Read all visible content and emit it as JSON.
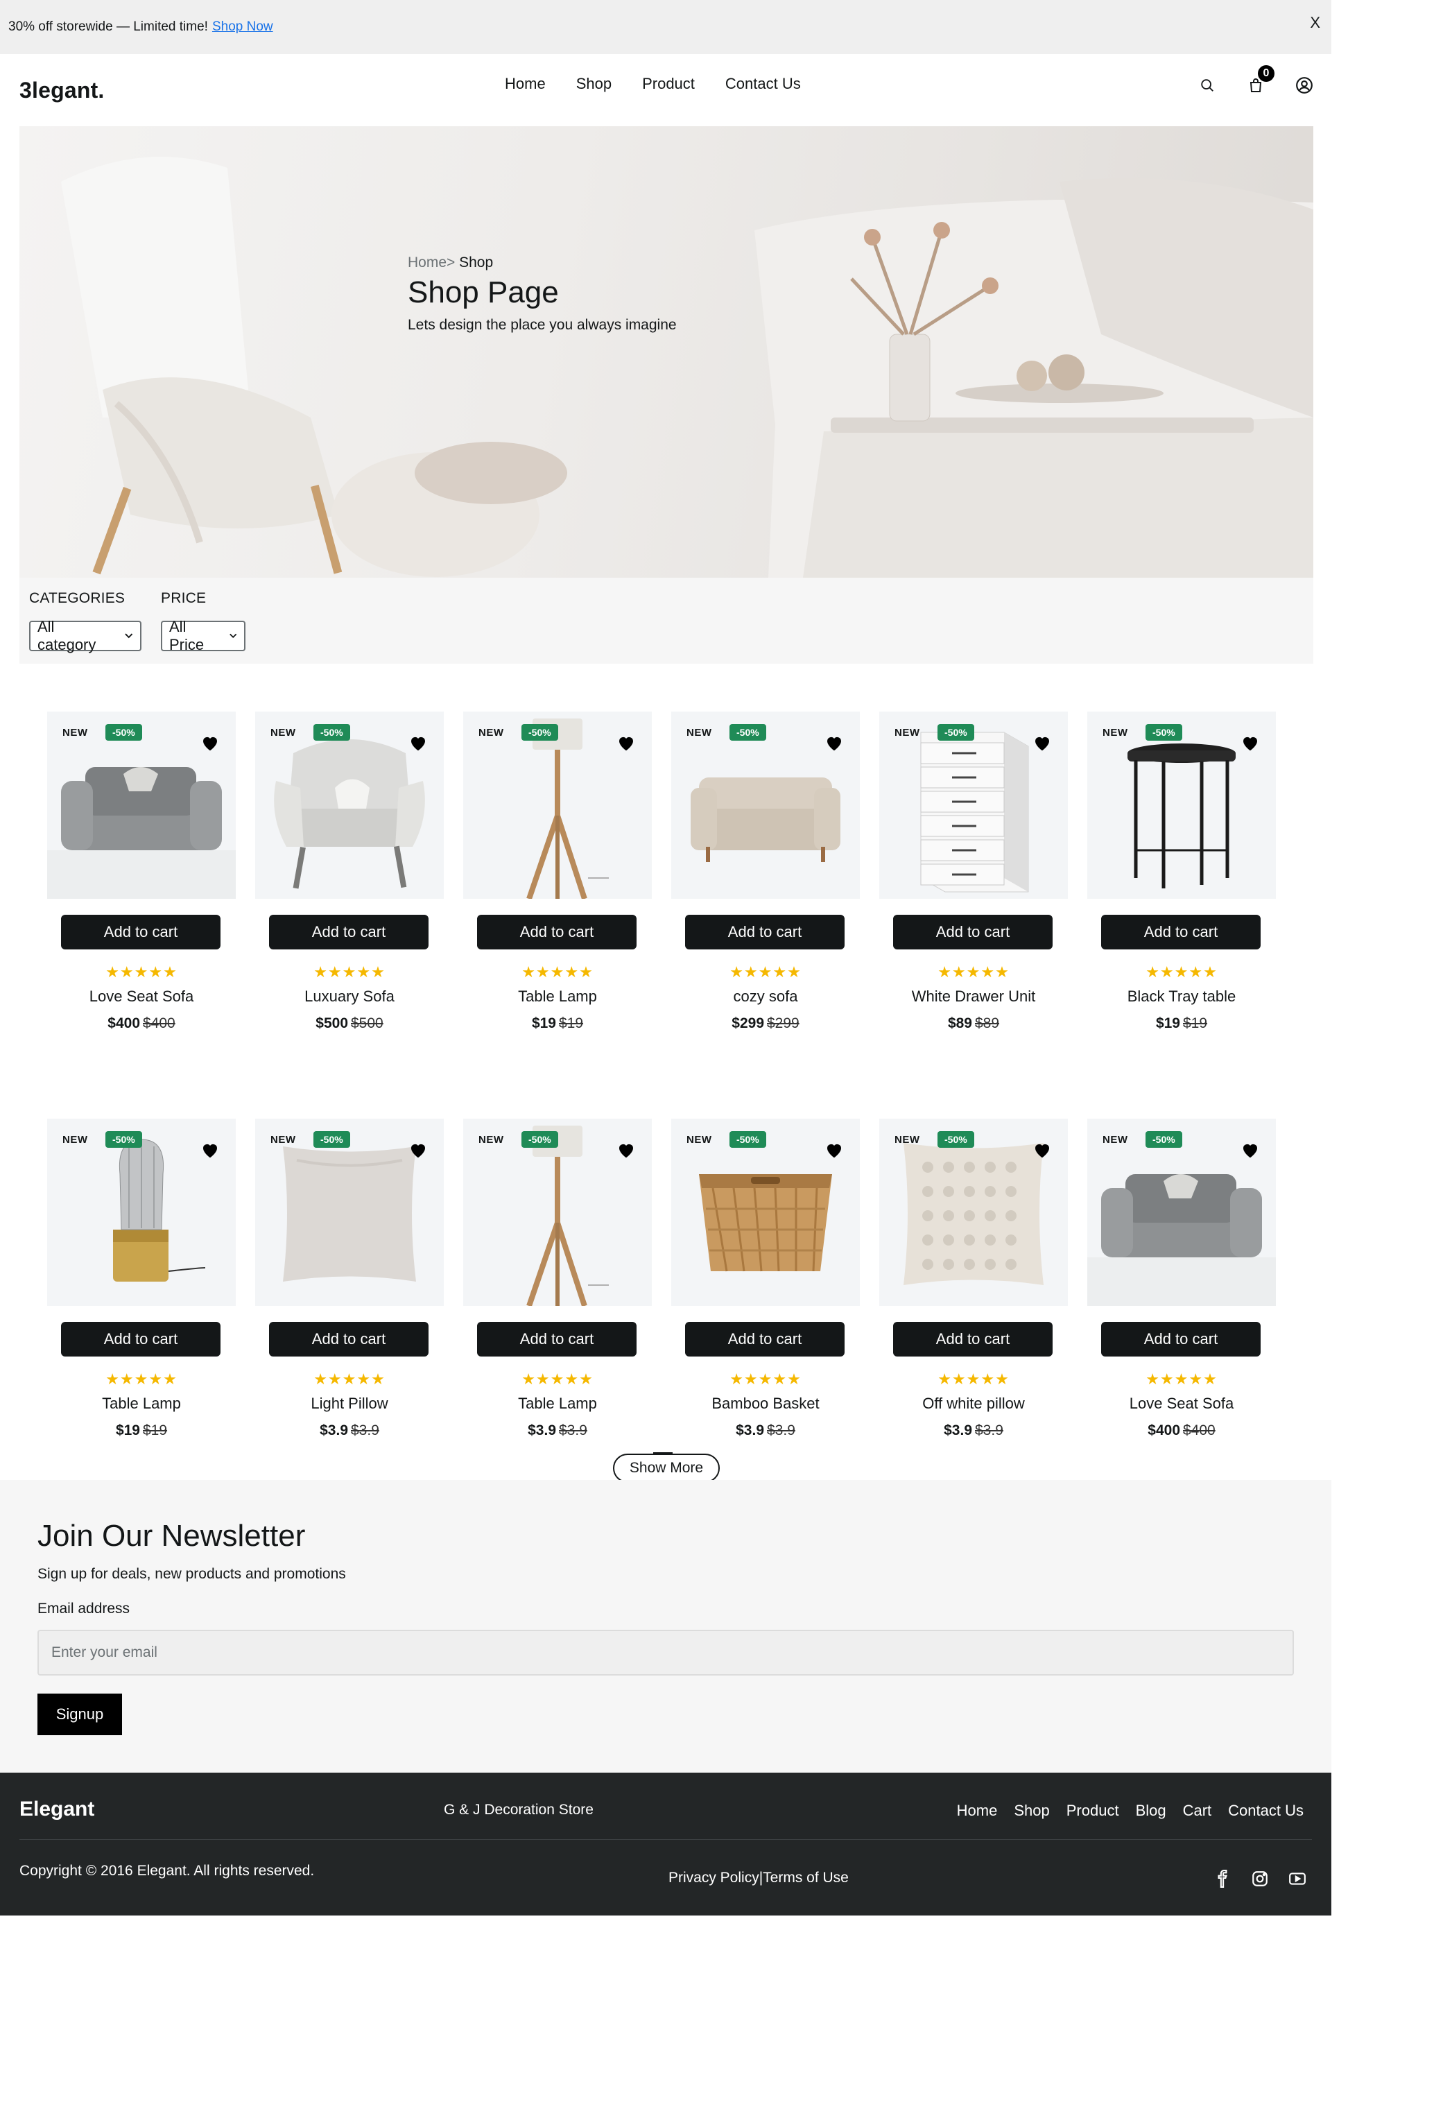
{
  "promo_bar": {
    "text": "30% off storewide — Limited time!",
    "link": "Shop Now",
    "close": "X"
  },
  "header": {
    "logo": "3legant.",
    "nav": [
      "Home",
      "Shop",
      "Product",
      "Contact Us"
    ],
    "cart_count": "0"
  },
  "hero": {
    "breadcrumb_home": "Home>",
    "breadcrumb_current": " Shop",
    "title": "Shop Page",
    "subtitle": "Lets design the place you always imagine"
  },
  "filters": {
    "categories_label": "CATEGORIES",
    "categories_value": "All category",
    "price_label": "PRICE",
    "price_value": "All Price"
  },
  "product_labels": {
    "new": "NEW",
    "discount": "-50%",
    "add_to_cart": "Add to cart",
    "stars": "★★★★★"
  },
  "products": [
    {
      "name": "Love Seat Sofa",
      "price": "$400",
      "old_price": "$400",
      "image": "armchair-gray"
    },
    {
      "name": "Luxuary Sofa",
      "price": "$500",
      "old_price": "$500",
      "image": "tufted-armchair"
    },
    {
      "name": "Table Lamp",
      "price": "$19",
      "old_price": "$19",
      "image": "tripod-floor-lamp"
    },
    {
      "name": "cozy sofa",
      "price": "$299",
      "old_price": "$299",
      "image": "beige-loveseat"
    },
    {
      "name": "White Drawer Unit",
      "price": "$89",
      "old_price": "$89",
      "image": "white-drawer-unit"
    },
    {
      "name": "Black Tray table",
      "price": "$19",
      "old_price": "$19",
      "image": "black-tray-table"
    },
    {
      "name": "Table Lamp",
      "price": "$19",
      "old_price": "$19",
      "image": "glass-table-lamp"
    },
    {
      "name": "Light Pillow",
      "price": "$3.9",
      "old_price": "$3.9",
      "image": "light-pillow"
    },
    {
      "name": "Table Lamp",
      "price": "$3.9",
      "old_price": "$3.9",
      "image": "tripod-floor-lamp"
    },
    {
      "name": "Bamboo Basket",
      "price": "$3.9",
      "old_price": "$3.9",
      "image": "bamboo-basket"
    },
    {
      "name": "Off white pillow",
      "price": "$3.9",
      "old_price": "$3.9",
      "image": "textured-pillow"
    },
    {
      "name": "Love Seat Sofa",
      "price": "$400",
      "old_price": "$400",
      "image": "armchair-gray"
    }
  ],
  "show_more": "Show More",
  "newsletter": {
    "title": "Join Our Newsletter",
    "subtitle": "Sign up for deals, new products and promotions",
    "email_label": "Email address",
    "email_placeholder": "Enter your email",
    "signup": "Signup"
  },
  "footer": {
    "logo": "Elegant",
    "store": "G & J Decoration Store",
    "nav": [
      "Home",
      "Shop",
      "Product",
      "Blog",
      "Cart",
      "Contact Us"
    ],
    "copyright": "Copyright © 2016 Elegant. All rights reserved.",
    "privacy": "Privacy Policy",
    "separator": " |",
    "terms": "Terms of Use",
    "social": [
      "facebook-icon",
      "instagram-icon",
      "youtube-icon"
    ]
  },
  "colors": {
    "accent_badge": "#1f8b57",
    "button": "#141718",
    "stars": "#f5b800",
    "footer_bg": "#232627"
  }
}
